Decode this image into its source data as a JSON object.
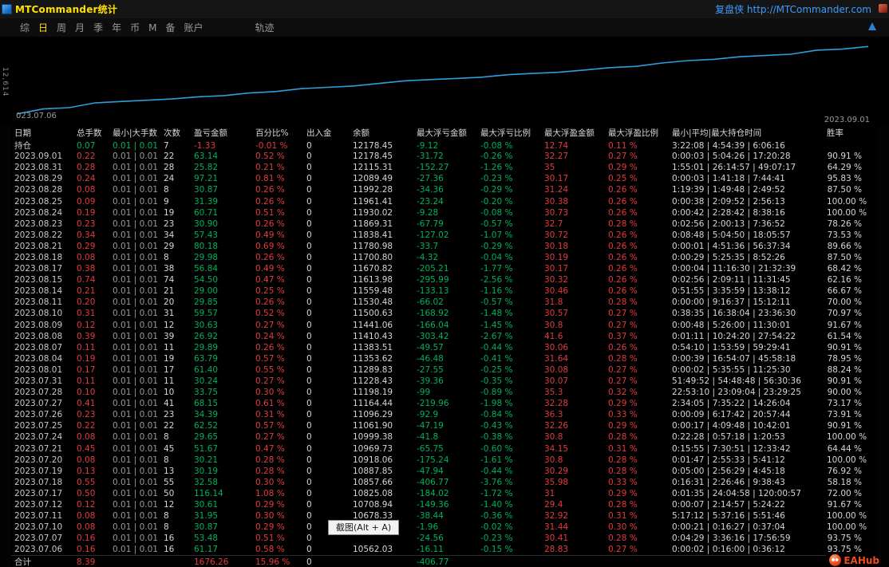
{
  "titlebar": {
    "title": "MTCommander统计",
    "link": "复盘侠 http://MTCommander.com"
  },
  "menu": {
    "active": "日",
    "items": [
      {
        "id": "zong",
        "label": "综"
      },
      {
        "id": "ri",
        "label": "日"
      },
      {
        "id": "zhou",
        "label": "周"
      },
      {
        "id": "yue",
        "label": "月"
      },
      {
        "id": "ji",
        "label": "季"
      },
      {
        "id": "nian",
        "label": "年"
      },
      {
        "id": "bi",
        "label": "币"
      },
      {
        "id": "m",
        "label": "M"
      },
      {
        "id": "bei",
        "label": "备"
      },
      {
        "id": "zhanghu",
        "label": "账户"
      },
      {
        "id": "guiji",
        "label": "轨迹",
        "gap": true
      }
    ]
  },
  "chart": {
    "y_axis_label": "12,614",
    "start_label": "023.07.06",
    "end_label": "2023.09.01"
  },
  "chart_data": {
    "type": "line",
    "series": [
      {
        "name": "余额",
        "values": [
          10562.03,
          10678.33,
          10708.94,
          10825.08,
          10857.66,
          10887.85,
          10918.06,
          10969.73,
          10999.38,
          11061.9,
          11096.29,
          11164.44,
          11198.19,
          11228.43,
          11289.83,
          11353.62,
          11383.51,
          11410.43,
          11441.06,
          11500.63,
          11530.48,
          11559.48,
          11613.98,
          11670.82,
          11700.8,
          11780.98,
          11838.41,
          11869.31,
          11930.02,
          11961.41,
          11992.28,
          12089.49,
          12115.31,
          12178.45
        ]
      }
    ],
    "x_start_label": "023.07.06",
    "x_end_label": "2023.09.01",
    "ylim": [
      10480,
      12260
    ],
    "line_color": "#2f9fdc",
    "grid": false,
    "legend": false
  },
  "tooltip": {
    "text": "截图(Alt + A)"
  },
  "footer": {
    "logo_text": "EAHub"
  },
  "colors": {
    "accent_yellow": "#ffe100",
    "link_blue": "#3d9bff",
    "up_red": "#e23b3b",
    "down_green": "#00b25a",
    "line_blue": "#2f9fdc"
  },
  "table": {
    "columns": [
      {
        "id": "date",
        "label": "日期"
      },
      {
        "id": "total-lots",
        "label": "总手数"
      },
      {
        "id": "min-max-lots",
        "label": "最小|大手数"
      },
      {
        "id": "count",
        "label": "次数"
      },
      {
        "id": "profit",
        "label": "盈亏金额"
      },
      {
        "id": "percent",
        "label": "百分比%"
      },
      {
        "id": "deposit-withdrawal",
        "label": "出入金"
      },
      {
        "id": "balance",
        "label": "余额"
      },
      {
        "id": "max-float-loss",
        "label": "最大浮亏金额"
      },
      {
        "id": "max-float-loss-pct",
        "label": "最大浮亏比例"
      },
      {
        "id": "max-float-profit",
        "label": "最大浮盈金额"
      },
      {
        "id": "max-float-profit-pct",
        "label": "最大浮盈比例"
      },
      {
        "id": "holding-time",
        "label": "最小|平均|最大持仓时间"
      },
      {
        "id": "win-rate",
        "label": "胜率"
      }
    ],
    "row_colors": {
      "position": "dggwrrwwggrrww",
      "daily": "drswgrwwggrrww",
      "total": "drswrrwwggrrww"
    },
    "rows": [
      {
        "label": "持仓",
        "type": "position",
        "cells": [
          "0.07",
          "0.01 | 0.01",
          "7",
          "-1.33",
          "-0.01 %",
          "0",
          "12178.45",
          "-9.12",
          "-0.08 %",
          "12.74",
          "0.11 %",
          "3:22:08 | 4:54:39 | 6:06:16",
          ""
        ]
      },
      {
        "label": "2023.09.01",
        "type": "daily",
        "cells": [
          "0.22",
          "0.01 | 0.01",
          "22",
          "63.14",
          "0.52 %",
          "0",
          "12178.45",
          "-31.72",
          "-0.26 %",
          "32.27",
          "0.27 %",
          "0:00:03 | 5:04:26 | 17:20:28",
          "90.91 %"
        ]
      },
      {
        "label": "2023.08.31",
        "type": "daily",
        "cells": [
          "0.28",
          "0.01 | 0.01",
          "28",
          "25.82",
          "0.21 %",
          "0",
          "12115.31",
          "-152.27",
          "-1.26 %",
          "35",
          "0.29 %",
          "1:55:01 | 26:14:57 | 49:07:17",
          "64.29 %"
        ]
      },
      {
        "label": "2023.08.29",
        "type": "daily",
        "cells": [
          "0.24",
          "0.01 | 0.01",
          "24",
          "97.21",
          "0.81 %",
          "0",
          "12089.49",
          "-27.36",
          "-0.23 %",
          "30.17",
          "0.25 %",
          "0:00:03 | 1:41:18 | 7:44:41",
          "95.83 %"
        ]
      },
      {
        "label": "2023.08.28",
        "type": "daily",
        "cells": [
          "0.08",
          "0.01 | 0.01",
          "8",
          "30.87",
          "0.26 %",
          "0",
          "11992.28",
          "-34.36",
          "-0.29 %",
          "31.24",
          "0.26 %",
          "1:19:39 | 1:49:48 | 2:49:52",
          "87.50 %"
        ]
      },
      {
        "label": "2023.08.25",
        "type": "daily",
        "cells": [
          "0.09",
          "0.01 | 0.01",
          "9",
          "31.39",
          "0.26 %",
          "0",
          "11961.41",
          "-23.24",
          "-0.20 %",
          "30.38",
          "0.26 %",
          "0:00:38 | 2:09:52 | 2:56:13",
          "100.00 %"
        ]
      },
      {
        "label": "2023.08.24",
        "type": "daily",
        "cells": [
          "0.19",
          "0.01 | 0.01",
          "19",
          "60.71",
          "0.51 %",
          "0",
          "11930.02",
          "-9.28",
          "-0.08 %",
          "30.73",
          "0.26 %",
          "0:00:42 | 2:28:42 | 8:38:16",
          "100.00 %"
        ]
      },
      {
        "label": "2023.08.23",
        "type": "daily",
        "cells": [
          "0.23",
          "0.01 | 0.01",
          "23",
          "30.90",
          "0.26 %",
          "0",
          "11869.31",
          "-67.79",
          "-0.57 %",
          "32.7",
          "0.28 %",
          "0:02:56 | 2:00:13 | 7:36:52",
          "78.26 %"
        ]
      },
      {
        "label": "2023.08.22",
        "type": "daily",
        "cells": [
          "0.34",
          "0.01 | 0.01",
          "34",
          "57.43",
          "0.49 %",
          "0",
          "11838.41",
          "-127.02",
          "-1.07 %",
          "30.72",
          "0.26 %",
          "0:08:48 | 5:04:50 | 18:05:57",
          "73.53 %"
        ]
      },
      {
        "label": "2023.08.21",
        "type": "daily",
        "cells": [
          "0.29",
          "0.01 | 0.01",
          "29",
          "80.18",
          "0.69 %",
          "0",
          "11780.98",
          "-33.7",
          "-0.29 %",
          "30.18",
          "0.26 %",
          "0:00:01 | 4:51:36 | 56:37:34",
          "89.66 %"
        ]
      },
      {
        "label": "2023.08.18",
        "type": "daily",
        "cells": [
          "0.08",
          "0.01 | 0.01",
          "8",
          "29.98",
          "0.26 %",
          "0",
          "11700.80",
          "-4.32",
          "-0.04 %",
          "30.19",
          "0.26 %",
          "0:00:29 | 5:25:35 | 8:52:26",
          "87.50 %"
        ]
      },
      {
        "label": "2023.08.17",
        "type": "daily",
        "cells": [
          "0.38",
          "0.01 | 0.01",
          "38",
          "56.84",
          "0.49 %",
          "0",
          "11670.82",
          "-205.21",
          "-1.77 %",
          "30.17",
          "0.26 %",
          "0:00:04 | 11:16:30 | 21:32:39",
          "68.42 %"
        ]
      },
      {
        "label": "2023.08.15",
        "type": "daily",
        "cells": [
          "0.74",
          "0.01 | 0.01",
          "74",
          "54.50",
          "0.47 %",
          "0",
          "11613.98",
          "-295.99",
          "-2.56 %",
          "30.32",
          "0.26 %",
          "0:02:56 | 2:09:11 | 11:31:45",
          "62.16 %"
        ]
      },
      {
        "label": "2023.08.14",
        "type": "daily",
        "cells": [
          "0.21",
          "0.01 | 0.01",
          "21",
          "29.00",
          "0.25 %",
          "0",
          "11559.48",
          "-133.13",
          "-1.16 %",
          "30.46",
          "0.26 %",
          "0:51:55 | 3:35:59 | 13:38:12",
          "66.67 %"
        ]
      },
      {
        "label": "2023.08.11",
        "type": "daily",
        "cells": [
          "0.20",
          "0.01 | 0.01",
          "20",
          "29.85",
          "0.26 %",
          "0",
          "11530.48",
          "-66.02",
          "-0.57 %",
          "31.8",
          "0.28 %",
          "0:00:00 | 9:16:37 | 15:12:11",
          "70.00 %"
        ]
      },
      {
        "label": "2023.08.10",
        "type": "daily",
        "cells": [
          "0.31",
          "0.01 | 0.01",
          "31",
          "59.57",
          "0.52 %",
          "0",
          "11500.63",
          "-168.92",
          "-1.48 %",
          "30.57",
          "0.27 %",
          "0:38:35 | 16:38:04 | 23:36:30",
          "70.97 %"
        ]
      },
      {
        "label": "2023.08.09",
        "type": "daily",
        "cells": [
          "0.12",
          "0.01 | 0.01",
          "12",
          "30.63",
          "0.27 %",
          "0",
          "11441.06",
          "-166.04",
          "-1.45 %",
          "30.8",
          "0.27 %",
          "0:00:48 | 5:26:00 | 11:30:01",
          "91.67 %"
        ]
      },
      {
        "label": "2023.08.08",
        "type": "daily",
        "cells": [
          "0.39",
          "0.01 | 0.01",
          "39",
          "26.92",
          "0.24 %",
          "0",
          "11410.43",
          "-303.42",
          "-2.67 %",
          "41.6",
          "0.37 %",
          "0:01:11 | 10:24:20 | 27:54:22",
          "61.54 %"
        ]
      },
      {
        "label": "2023.08.07",
        "type": "daily",
        "cells": [
          "0.11",
          "0.01 | 0.01",
          "11",
          "29.89",
          "0.26 %",
          "0",
          "11383.51",
          "-49.57",
          "-0.44 %",
          "30.06",
          "0.26 %",
          "0:54:10 | 1:53:59 | 59:29:41",
          "90.91 %"
        ]
      },
      {
        "label": "2023.08.04",
        "type": "daily",
        "cells": [
          "0.19",
          "0.01 | 0.01",
          "19",
          "63.79",
          "0.57 %",
          "0",
          "11353.62",
          "-46.48",
          "-0.41 %",
          "31.64",
          "0.28 %",
          "0:00:39 | 16:54:07 | 45:58:18",
          "78.95 %"
        ]
      },
      {
        "label": "2023.08.01",
        "type": "daily",
        "cells": [
          "0.17",
          "0.01 | 0.01",
          "17",
          "61.40",
          "0.55 %",
          "0",
          "11289.83",
          "-27.55",
          "-0.25 %",
          "30.08",
          "0.27 %",
          "0:00:02 | 5:35:55 | 11:25:30",
          "88.24 %"
        ]
      },
      {
        "label": "2023.07.31",
        "type": "daily",
        "cells": [
          "0.11",
          "0.01 | 0.01",
          "11",
          "30.24",
          "0.27 %",
          "0",
          "11228.43",
          "-39.36",
          "-0.35 %",
          "30.07",
          "0.27 %",
          "51:49:52 | 54:48:48 | 56:30:36",
          "90.91 %"
        ]
      },
      {
        "label": "2023.07.28",
        "type": "daily",
        "cells": [
          "0.10",
          "0.01 | 0.01",
          "10",
          "33.75",
          "0.30 %",
          "0",
          "11198.19",
          "-99",
          "-0.89 %",
          "35.3",
          "0.32 %",
          "22:53:10 | 23:09:04 | 23:29:25",
          "90.00 %"
        ]
      },
      {
        "label": "2023.07.27",
        "type": "daily",
        "cells": [
          "0.41",
          "0.01 | 0.01",
          "41",
          "68.15",
          "0.61 %",
          "0",
          "11164.44",
          "-219.96",
          "-1.98 %",
          "32.28",
          "0.29 %",
          "2:34:05 | 7:35:22 | 14:26:04",
          "73.17 %"
        ]
      },
      {
        "label": "2023.07.26",
        "type": "daily",
        "cells": [
          "0.23",
          "0.01 | 0.01",
          "23",
          "34.39",
          "0.31 %",
          "0",
          "11096.29",
          "-92.9",
          "-0.84 %",
          "36.3",
          "0.33 %",
          "0:00:09 | 6:17:42 | 20:57:44",
          "73.91 %"
        ]
      },
      {
        "label": "2023.07.25",
        "type": "daily",
        "cells": [
          "0.22",
          "0.01 | 0.01",
          "22",
          "62.52",
          "0.57 %",
          "0",
          "11061.90",
          "-47.19",
          "-0.43 %",
          "32.26",
          "0.29 %",
          "0:00:17 | 4:09:48 | 10:42:01",
          "90.91 %"
        ]
      },
      {
        "label": "2023.07.24",
        "type": "daily",
        "cells": [
          "0.08",
          "0.01 | 0.01",
          "8",
          "29.65",
          "0.27 %",
          "0",
          "10999.38",
          "-41.8",
          "-0.38 %",
          "30.8",
          "0.28 %",
          "0:22:28 | 0:57:18 | 1:20:53",
          "100.00 %"
        ]
      },
      {
        "label": "2023.07.21",
        "type": "daily",
        "cells": [
          "0.45",
          "0.01 | 0.01",
          "45",
          "51.67",
          "0.47 %",
          "0",
          "10969.73",
          "-65.75",
          "-0.60 %",
          "34.15",
          "0.31 %",
          "0:15:55 | 7:30:51 | 12:33:42",
          "64.44 %"
        ]
      },
      {
        "label": "2023.07.20",
        "type": "daily",
        "cells": [
          "0.08",
          "0.01 | 0.01",
          "8",
          "30.21",
          "0.28 %",
          "0",
          "10918.06",
          "-175.24",
          "-1.61 %",
          "30.8",
          "0.28 %",
          "0:01:47 | 2:55:33 | 5:41:12",
          "100.00 %"
        ]
      },
      {
        "label": "2023.07.19",
        "type": "daily",
        "cells": [
          "0.13",
          "0.01 | 0.01",
          "13",
          "30.19",
          "0.28 %",
          "0",
          "10887.85",
          "-47.94",
          "-0.44 %",
          "30.29",
          "0.28 %",
          "0:05:00 | 2:56:29 | 4:45:18",
          "76.92 %"
        ]
      },
      {
        "label": "2023.07.18",
        "type": "daily",
        "cells": [
          "0.55",
          "0.01 | 0.01",
          "55",
          "32.58",
          "0.30 %",
          "0",
          "10857.66",
          "-406.77",
          "-3.76 %",
          "35.98",
          "0.33 %",
          "0:16:31 | 2:26:46 | 9:38:43",
          "58.18 %"
        ]
      },
      {
        "label": "2023.07.17",
        "type": "daily",
        "cells": [
          "0.50",
          "0.01 | 0.01",
          "50",
          "116.14",
          "1.08 %",
          "0",
          "10825.08",
          "-184.02",
          "-1.72 %",
          "31",
          "0.29 %",
          "0:01:35 | 24:04:58 | 120:00:57",
          "72.00 %"
        ]
      },
      {
        "label": "2023.07.12",
        "type": "daily",
        "cells": [
          "0.12",
          "0.01 | 0.01",
          "12",
          "30.61",
          "0.29 %",
          "0",
          "10708.94",
          "-149.36",
          "-1.40 %",
          "29.4",
          "0.28 %",
          "0:00:07 | 2:14:57 | 5:24:22",
          "91.67 %"
        ]
      },
      {
        "label": "2023.07.11",
        "type": "daily",
        "cells": [
          "0.08",
          "0.01 | 0.01",
          "8",
          "31.95",
          "0.30 %",
          "0",
          "10678.33",
          "-38.44",
          "-0.36 %",
          "32.92",
          "0.31 %",
          "5:17:12 | 5:37:16 | 5:51:46",
          "100.00 %"
        ]
      },
      {
        "label": "2023.07.10",
        "type": "daily",
        "cells": [
          "0.08",
          "0.01 | 0.01",
          "8",
          "30.87",
          "0.29 %",
          "0",
          "",
          "-1.96",
          "-0.02 %",
          "31.44",
          "0.30 %",
          "0:00:21 | 0:16:27 | 0:37:04",
          "100.00 %"
        ]
      },
      {
        "label": "2023.07.07",
        "type": "daily",
        "cells": [
          "0.16",
          "0.01 | 0.01",
          "16",
          "53.48",
          "0.51 %",
          "0",
          "",
          "-24.56",
          "-0.23 %",
          "30.41",
          "0.28 %",
          "0:04:29 | 3:36:16 | 17:56:59",
          "93.75 %"
        ]
      },
      {
        "label": "2023.07.06",
        "type": "daily",
        "cells": [
          "0.16",
          "0.01 | 0.01",
          "16",
          "61.17",
          "0.58 %",
          "0",
          "10562.03",
          "-16.11",
          "-0.15 %",
          "28.83",
          "0.27 %",
          "0:00:02 | 0:16:00 | 0:36:12",
          "93.75 %"
        ]
      },
      {
        "label": "合计",
        "type": "total",
        "cells": [
          "8.39",
          "",
          "",
          "1676.26",
          "15.96 %",
          "0",
          "",
          "-406.77",
          "",
          "",
          "",
          "",
          ""
        ]
      }
    ]
  }
}
